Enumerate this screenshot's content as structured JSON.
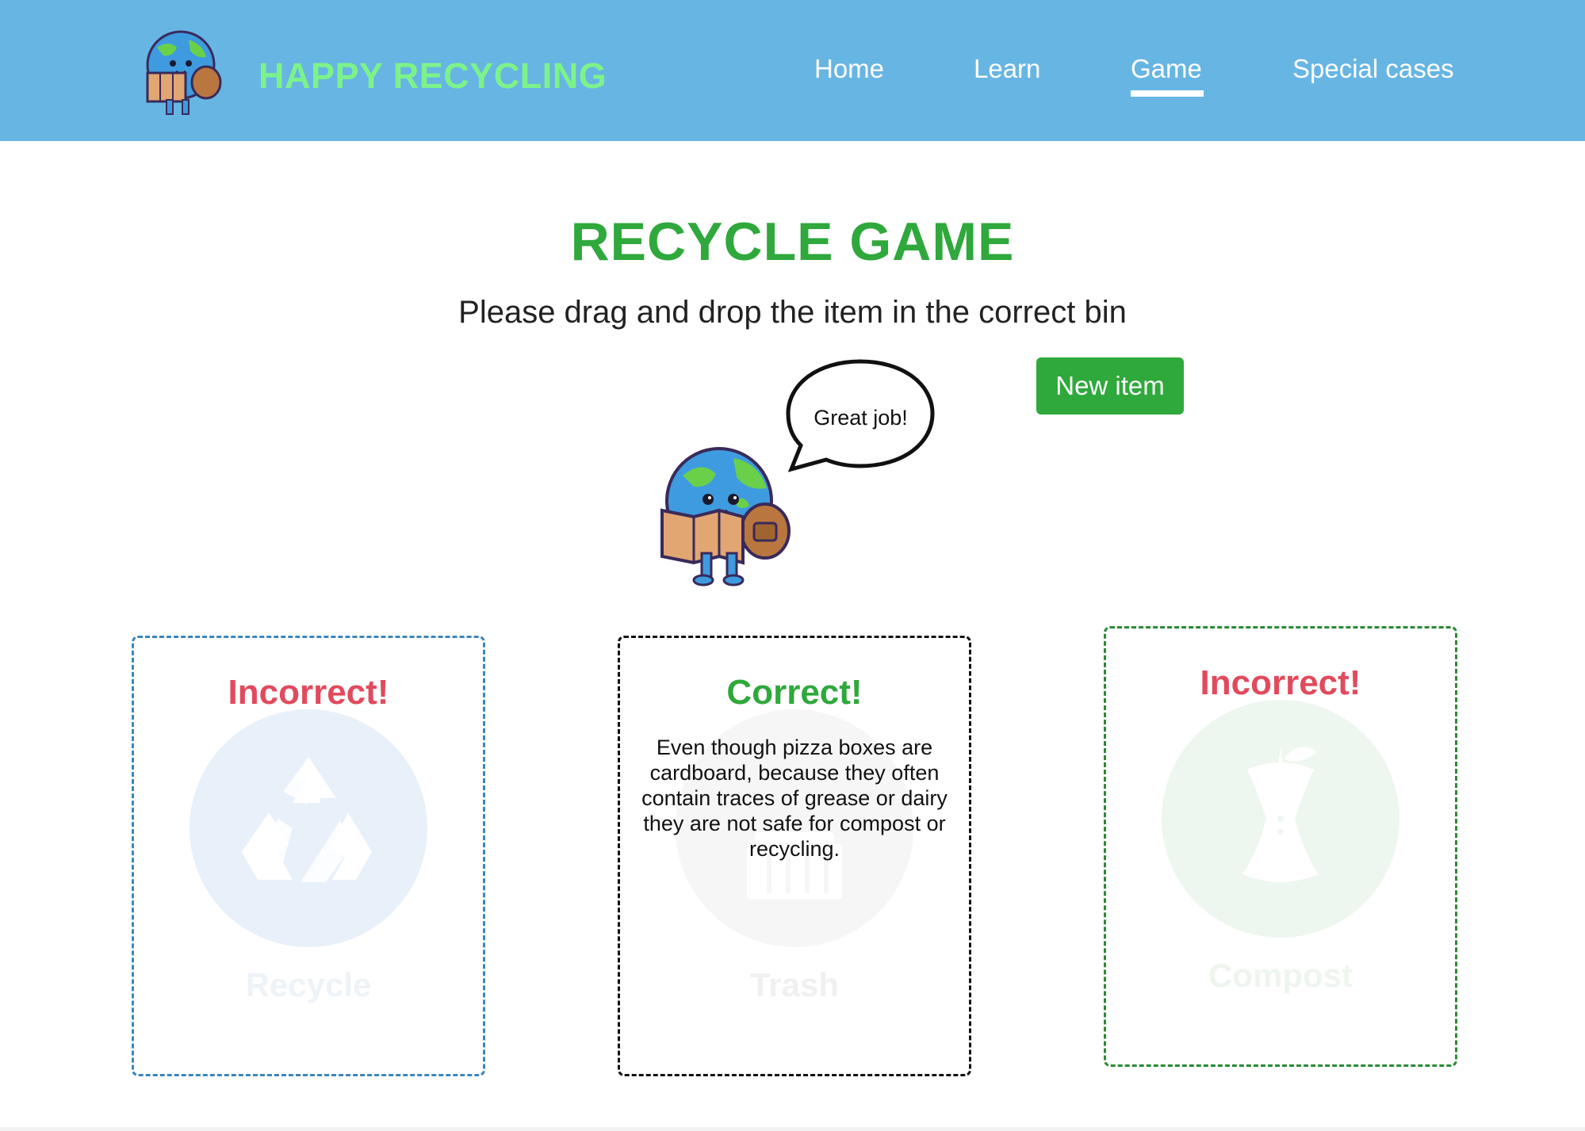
{
  "header": {
    "brand": "HAPPY RECYCLING",
    "logo_icon": "earth-mascot-icon",
    "nav": [
      {
        "label": "Home"
      },
      {
        "label": "Learn"
      },
      {
        "label": "Game",
        "active": true
      },
      {
        "label": "Special cases"
      }
    ],
    "background_color": "#67b5e3"
  },
  "main": {
    "title": "RECYCLE GAME",
    "subtitle": "Please drag and drop the item in the correct bin",
    "new_item_label": "New item",
    "speech_bubble": "Great job!",
    "mascot_icon": "earth-mascot-icon"
  },
  "bins": [
    {
      "label": "Recycle",
      "result": "Incorrect!",
      "status": "incorrect",
      "icon": "recycle-icon",
      "border_color": "#3b86be"
    },
    {
      "label": "Trash",
      "result": "Correct!",
      "status": "correct",
      "icon": "trash-icon",
      "border_color": "#111111",
      "explanation": "Even though pizza boxes are cardboard, because they often contain traces of grease or dairy they are not safe for compost or recycling."
    },
    {
      "label": "Compost",
      "result": "Incorrect!",
      "status": "incorrect",
      "icon": "apple-core-icon",
      "border_color": "#2b8a35"
    }
  ],
  "colors": {
    "accent_green": "#2fa83c",
    "incorrect_red": "#e24a5c",
    "brand_green": "#7cf38a"
  }
}
